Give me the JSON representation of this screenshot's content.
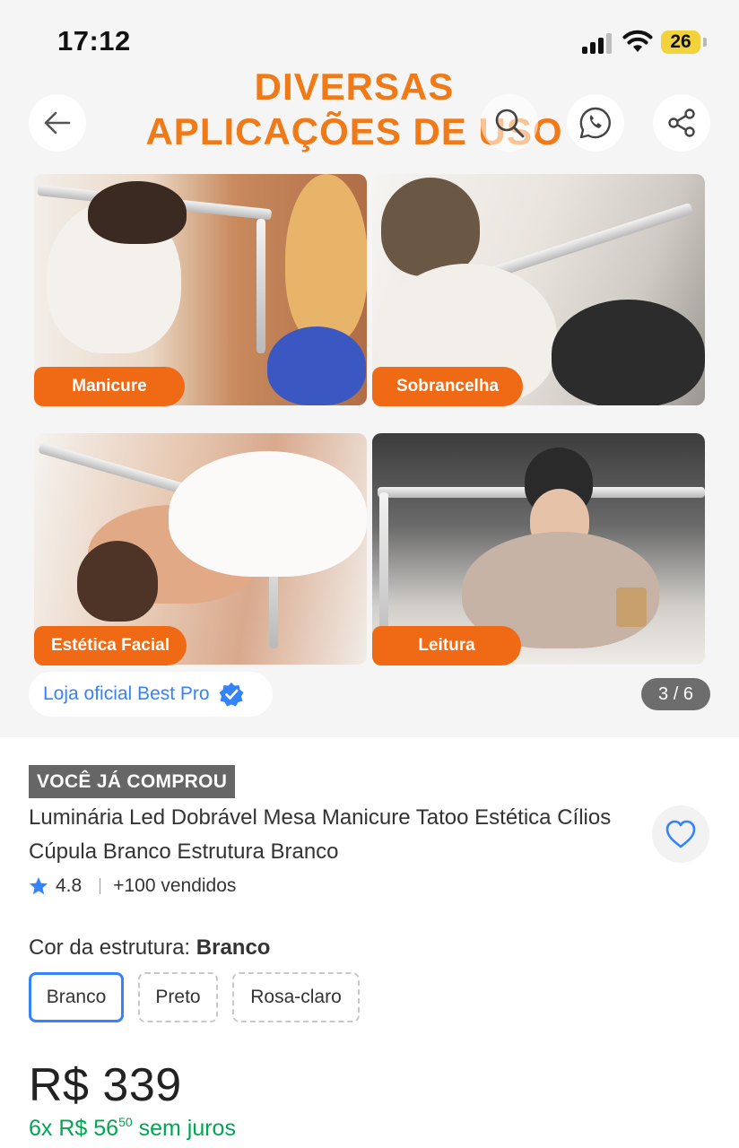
{
  "status_bar": {
    "time": "17:12",
    "battery": "26"
  },
  "gallery": {
    "headline_line1": "DIVERSAS",
    "headline_line2": "APLICAÇÕES DE USO",
    "tags": [
      "Manicure",
      "Sobrancelha",
      "Estética Facial",
      "Leitura"
    ],
    "store_name": "Loja oficial Best Pro",
    "counter": "3 / 6"
  },
  "product": {
    "badge": "VOCÊ JÁ COMPROU",
    "title": "Luminária Led Dobrável Mesa Manicure Tatoo Estética Cílios Cúpula Branco Estrutura Branco",
    "rating": "4.8",
    "sold": "+100 vendidos"
  },
  "variant": {
    "label": "Cor da estrutura:",
    "selected": "Branco",
    "options": [
      "Branco",
      "Preto",
      "Rosa-claro"
    ]
  },
  "price": {
    "main": "R$ 339",
    "installments_prefix": "6x R$ 56",
    "installments_cents": "50",
    "installments_suffix": "sem juros"
  },
  "colors": {
    "accent": "#3483fa",
    "orange": "#f06a16",
    "green": "#00a650"
  },
  "icons": [
    "arrow-left-icon",
    "search-icon",
    "whatsapp-icon",
    "share-icon",
    "verified-icon",
    "heart-icon",
    "star-icon"
  ]
}
